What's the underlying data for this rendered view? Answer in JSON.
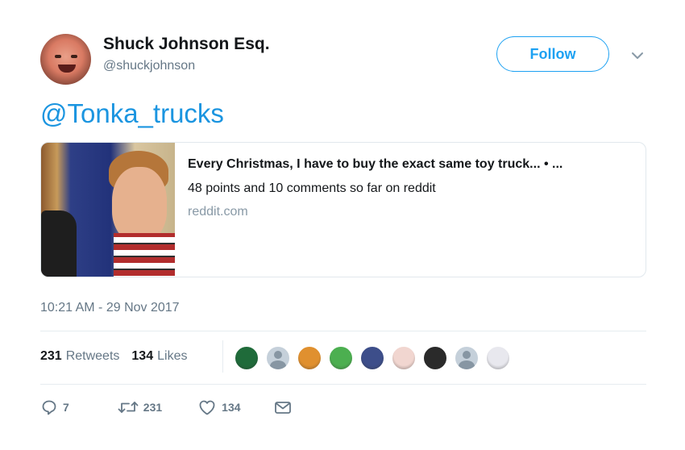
{
  "author": {
    "display_name": "Shuck Johnson Esq.",
    "handle": "@shuckjohnson"
  },
  "follow_label": "Follow",
  "tweet_text": "@Tonka_trucks",
  "card": {
    "title": "Every Christmas, I have to buy the exact same toy truck... • ...",
    "description": "48 points and 10 comments so far on reddit",
    "domain": "reddit.com"
  },
  "timestamp": "10:21 AM - 29 Nov 2017",
  "stats": {
    "retweets_count": "231",
    "retweets_label": "Retweets",
    "likes_count": "134",
    "likes_label": "Likes"
  },
  "liker_avatars": [
    {
      "name": "green-badge-avatar",
      "color": "#1f6b3a"
    },
    {
      "name": "default-avatar",
      "color": "#c5d0da"
    },
    {
      "name": "orange-face-avatar",
      "color": "#e0902f"
    },
    {
      "name": "pepe-avatar",
      "color": "#4caf50"
    },
    {
      "name": "blue-cartoon-avatar",
      "color": "#3d4e8a"
    },
    {
      "name": "pink-woman-avatar",
      "color": "#f1d6d0"
    },
    {
      "name": "dark-photo-avatar",
      "color": "#2a2a2a"
    },
    {
      "name": "default-avatar",
      "color": "#c5d0da"
    },
    {
      "name": "sketch-avatar",
      "color": "#e8e8ee"
    }
  ],
  "actions": {
    "reply_count": "7",
    "retweet_count": "231",
    "like_count": "134"
  },
  "colors": {
    "accent": "#1da1f2",
    "mention": "#1b95e0",
    "muted": "#657786"
  }
}
